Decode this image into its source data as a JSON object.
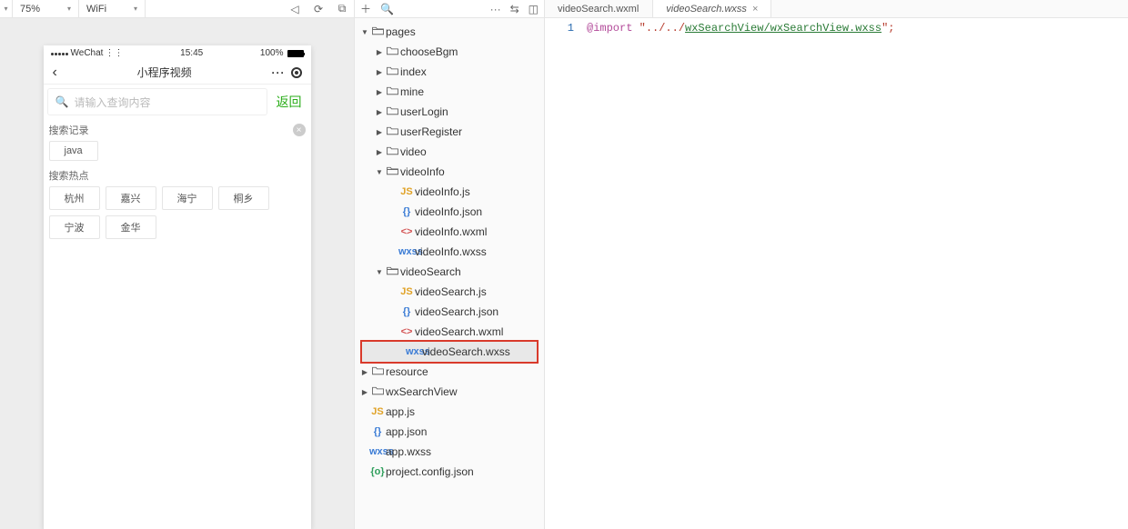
{
  "sim": {
    "zoom": "75%",
    "network": "WiFi",
    "toolbar_icons": {
      "mute": "mute",
      "rotate": "rotate",
      "copy": "copy"
    }
  },
  "phone": {
    "carrier": "WeChat",
    "time": "15:45",
    "battery": "100%",
    "nav_title": "小程序视频",
    "search_placeholder": "请输入查询内容",
    "return_label": "返回",
    "history_label": "搜索记录",
    "history_items": [
      "java"
    ],
    "hot_label": "搜索热点",
    "hot_items": [
      "杭州",
      "嘉兴",
      "海宁",
      "桐乡",
      "宁波",
      "金华"
    ]
  },
  "explorer": {
    "root": "pages",
    "folders": [
      {
        "name": "chooseBgm",
        "open": false
      },
      {
        "name": "index",
        "open": false
      },
      {
        "name": "mine",
        "open": false
      },
      {
        "name": "userLogin",
        "open": false
      },
      {
        "name": "userRegister",
        "open": false
      },
      {
        "name": "video",
        "open": false
      }
    ],
    "videoInfo": {
      "name": "videoInfo",
      "files": [
        "videoInfo.js",
        "videoInfo.json",
        "videoInfo.wxml",
        "videoInfo.wxss"
      ]
    },
    "videoSearch": {
      "name": "videoSearch",
      "files": [
        "videoSearch.js",
        "videoSearch.json",
        "videoSearch.wxml",
        "videoSearch.wxss"
      ]
    },
    "rootSiblings": [
      {
        "name": "resource",
        "type": "folder"
      },
      {
        "name": "wxSearchView",
        "type": "folder"
      }
    ],
    "rootFiles": [
      {
        "name": "app.js",
        "type": "js"
      },
      {
        "name": "app.json",
        "type": "json"
      },
      {
        "name": "app.wxss",
        "type": "wxss"
      },
      {
        "name": "project.config.json",
        "type": "proj"
      }
    ],
    "selected": "videoSearch.wxss"
  },
  "editor": {
    "tabs": [
      {
        "label": "videoSearch.wxml",
        "active": false,
        "closeable": false
      },
      {
        "label": "videoSearch.wxss",
        "active": true,
        "closeable": true
      }
    ],
    "line_no": "1",
    "code": {
      "kw": "@import",
      "q1": " \"../../",
      "path": "wxSearchView/wxSearchView.wxss",
      "q2": "\";"
    }
  }
}
